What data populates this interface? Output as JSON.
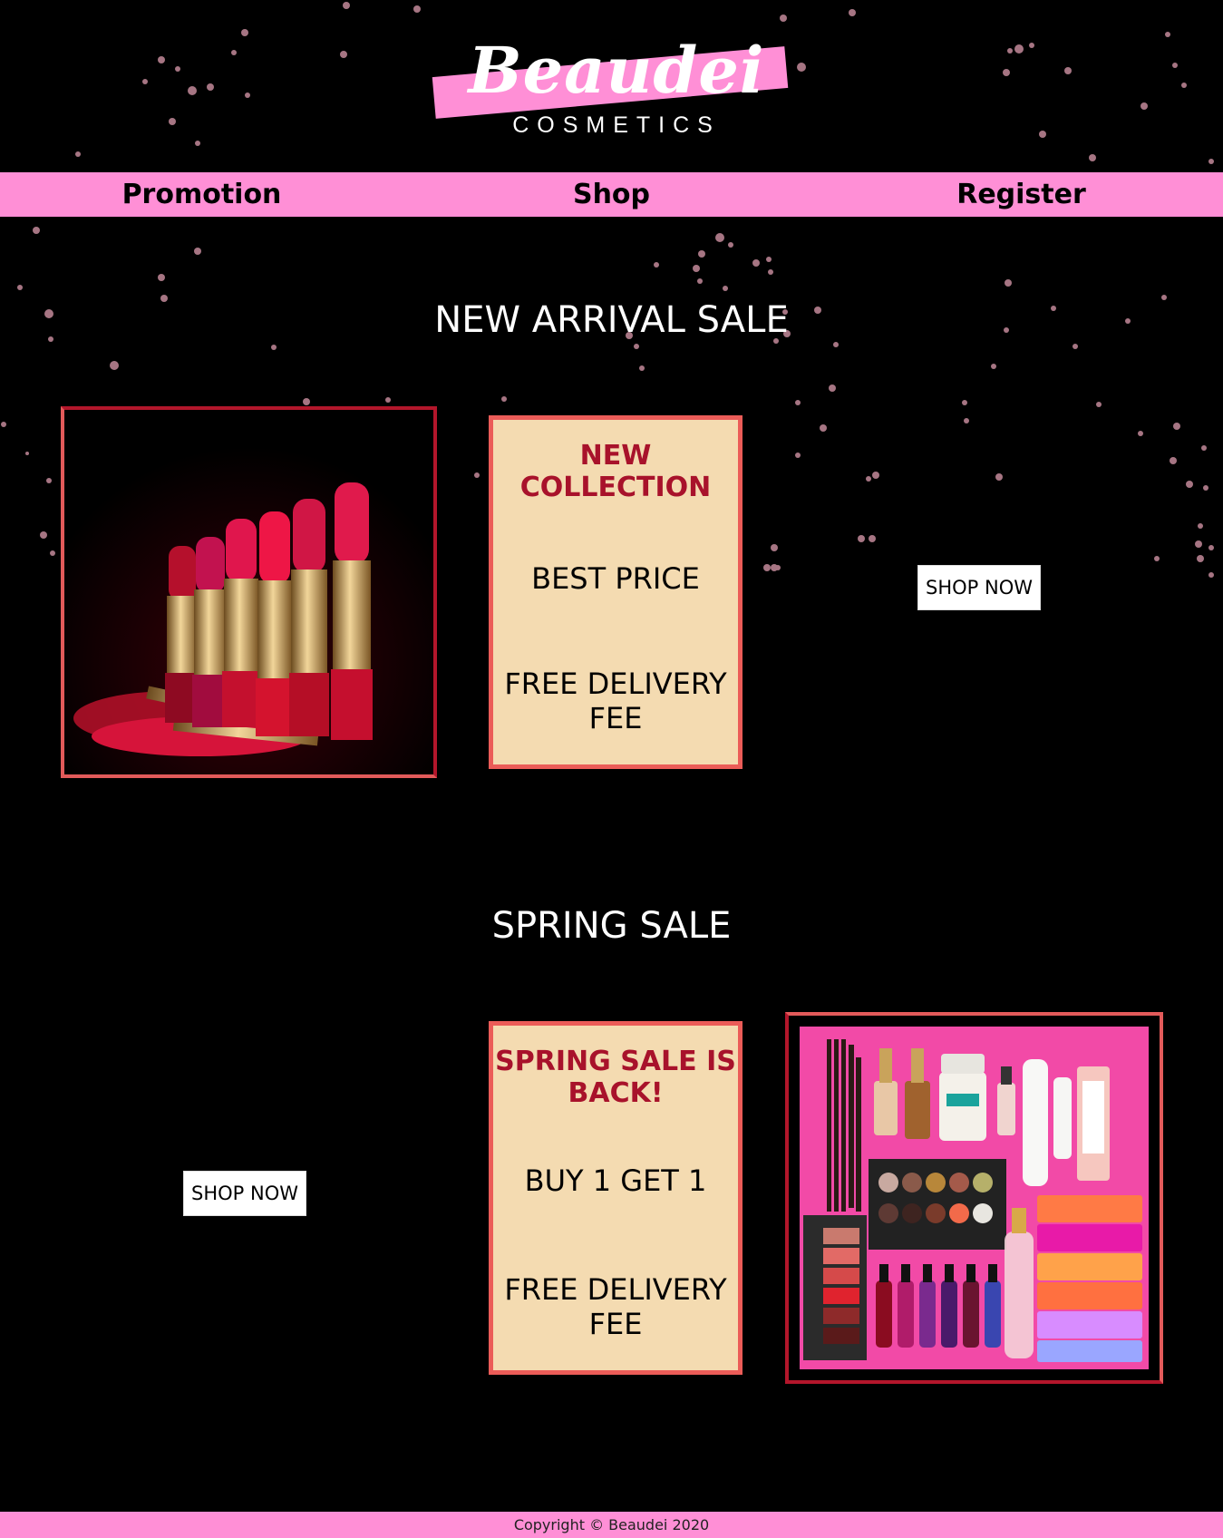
{
  "brand": {
    "logo_script": "Beaudei",
    "logo_sub": "COSMETICS"
  },
  "nav": {
    "items": [
      {
        "label": "Promotion"
      },
      {
        "label": "Shop"
      },
      {
        "label": "Register"
      }
    ]
  },
  "sections": [
    {
      "title": "NEW ARRIVAL SALE",
      "info": {
        "headline": "NEW COLLECTION",
        "line1": "BEST PRICE",
        "line2": "FREE DELIVERY FEE"
      },
      "button": "SHOP NOW",
      "image": "lipstick-row-image"
    },
    {
      "title": "SPRING SALE",
      "info": {
        "headline": "SPRING SALE IS BACK!",
        "line1": "BUY 1 GET 1",
        "line2": "FREE DELIVERY FEE"
      },
      "button": "SHOP NOW",
      "image": "cosmetics-flatlay-image"
    }
  ],
  "footer": {
    "copyright": "Copyright © Beaudei 2020"
  },
  "colors": {
    "background": "#000000",
    "accent_pink": "#ff8fd6",
    "box_fill": "#f4dbb1",
    "box_border": "#eb5c58",
    "headline_red": "#a8122b"
  }
}
